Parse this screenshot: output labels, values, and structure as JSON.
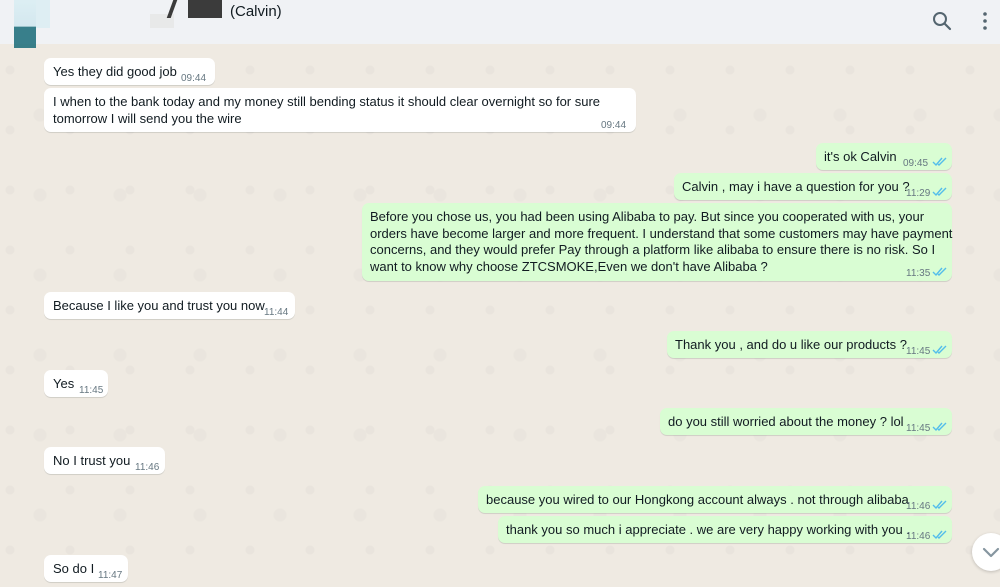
{
  "header": {
    "contact_name": "(Calvin)"
  },
  "messages": [
    {
      "dir": "in",
      "text": "Yes they did good job",
      "time": "09:44"
    },
    {
      "dir": "in",
      "text": "I when to the bank today and my money still bending status it should clear overnight so for sure\ntomorrow I will send you the wire",
      "time": "09:44"
    },
    {
      "dir": "out",
      "text": "it's ok Calvin",
      "time": "09:45"
    },
    {
      "dir": "out",
      "text": "Calvin , may i have a question for you ?",
      "time": "11:29"
    },
    {
      "dir": "out",
      "text": "Before you chose us, you had been using Alibaba to pay. But since you cooperated with us, your\norders have become larger and more frequent. I understand that some customers may have payment\nconcerns, and they would prefer Pay through a platform like alibaba to ensure there is no risk. So I\nwant to know why choose ZTCSMOKE,Even we don't have Alibaba ?",
      "time": "11:35"
    },
    {
      "dir": "in",
      "text": "Because I like you and trust you now",
      "time": "11:44"
    },
    {
      "dir": "out",
      "text": "Thank you , and do u like our products ?",
      "time": "11:45"
    },
    {
      "dir": "in",
      "text": "Yes",
      "time": "11:45"
    },
    {
      "dir": "out",
      "text": "do you still worried about the money ? lol",
      "time": "11:45"
    },
    {
      "dir": "in",
      "text": "No I trust you",
      "time": "11:46"
    },
    {
      "dir": "out",
      "text": "because you wired to our Hongkong account always . not through alibaba",
      "time": "11:46"
    },
    {
      "dir": "out",
      "text": "thank you so much i appreciate . we are very happy working with you .",
      "time": "11:46"
    },
    {
      "dir": "in",
      "text": "So do I",
      "time": "11:47"
    }
  ],
  "colors": {
    "incoming_bubble": "#ffffff",
    "outgoing_bubble": "#d9fdd3",
    "read_ticks": "#53bdeb",
    "background": "#efeae2"
  },
  "icons": {
    "search": "search-icon",
    "menu": "more-vertical-icon",
    "scroll": "chevron-down-icon",
    "read": "double-check-icon"
  }
}
